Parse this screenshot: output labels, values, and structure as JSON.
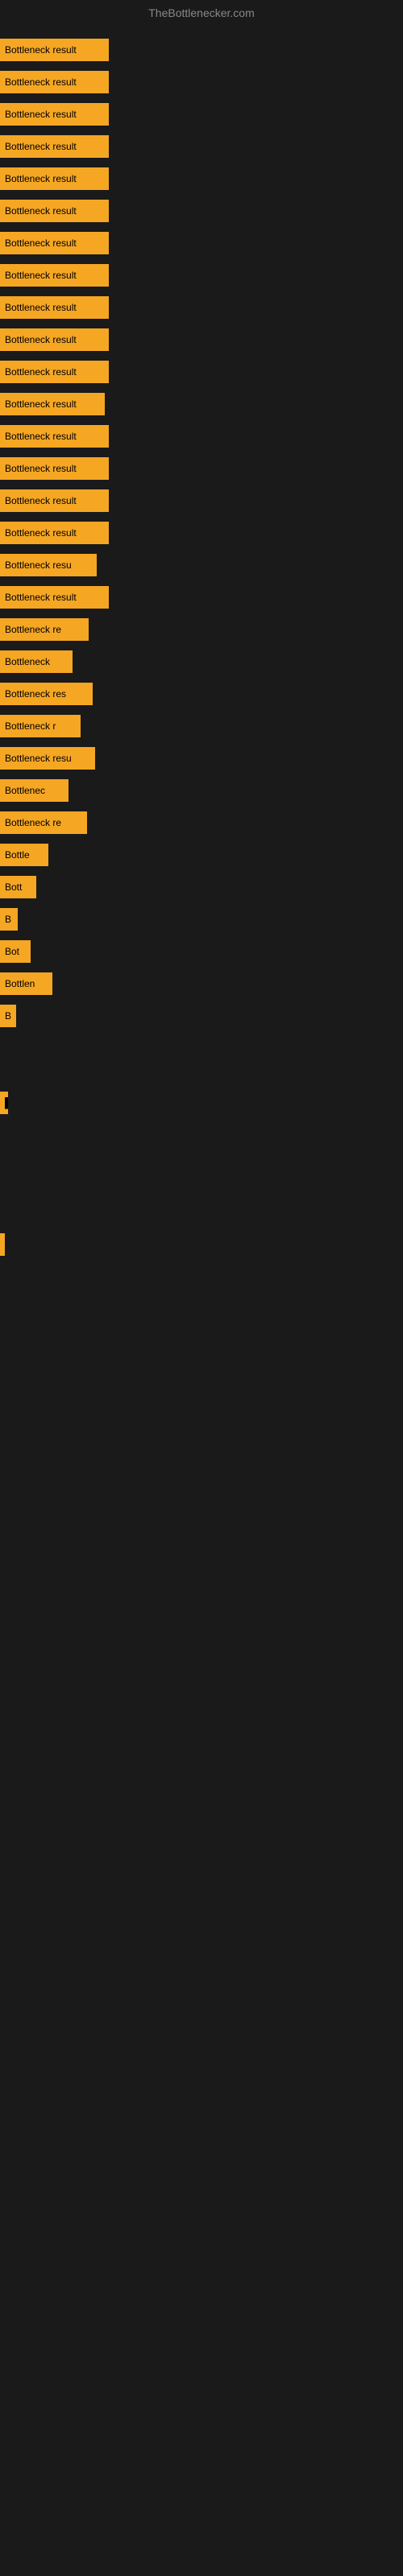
{
  "site": {
    "title": "TheBottlenecker.com"
  },
  "bars": [
    {
      "label": "Bottleneck result",
      "width": 135
    },
    {
      "label": "Bottleneck result",
      "width": 135
    },
    {
      "label": "Bottleneck result",
      "width": 135
    },
    {
      "label": "Bottleneck result",
      "width": 135
    },
    {
      "label": "Bottleneck result",
      "width": 135
    },
    {
      "label": "Bottleneck result",
      "width": 135
    },
    {
      "label": "Bottleneck result",
      "width": 135
    },
    {
      "label": "Bottleneck result",
      "width": 135
    },
    {
      "label": "Bottleneck result",
      "width": 135
    },
    {
      "label": "Bottleneck result",
      "width": 135
    },
    {
      "label": "Bottleneck result",
      "width": 135
    },
    {
      "label": "Bottleneck result",
      "width": 130
    },
    {
      "label": "Bottleneck result",
      "width": 135
    },
    {
      "label": "Bottleneck result",
      "width": 135
    },
    {
      "label": "Bottleneck result",
      "width": 135
    },
    {
      "label": "Bottleneck result",
      "width": 135
    },
    {
      "label": "Bottleneck resu",
      "width": 120
    },
    {
      "label": "Bottleneck result",
      "width": 135
    },
    {
      "label": "Bottleneck re",
      "width": 110
    },
    {
      "label": "Bottleneck",
      "width": 90
    },
    {
      "label": "Bottleneck res",
      "width": 115
    },
    {
      "label": "Bottleneck r",
      "width": 100
    },
    {
      "label": "Bottleneck resu",
      "width": 118
    },
    {
      "label": "Bottlenec",
      "width": 85
    },
    {
      "label": "Bottleneck re",
      "width": 108
    },
    {
      "label": "Bottle",
      "width": 60
    },
    {
      "label": "Bott",
      "width": 45
    },
    {
      "label": "B",
      "width": 22
    },
    {
      "label": "Bot",
      "width": 38
    },
    {
      "label": "Bottlen",
      "width": 65
    },
    {
      "label": "B",
      "width": 20
    },
    {
      "label": "",
      "width": 0
    },
    {
      "label": "",
      "width": 0
    },
    {
      "label": "▌",
      "width": 10
    },
    {
      "label": "",
      "width": 0
    },
    {
      "label": "",
      "width": 0
    },
    {
      "label": "",
      "width": 0
    },
    {
      "label": "",
      "width": 0
    },
    {
      "label": "",
      "width": 5
    }
  ]
}
